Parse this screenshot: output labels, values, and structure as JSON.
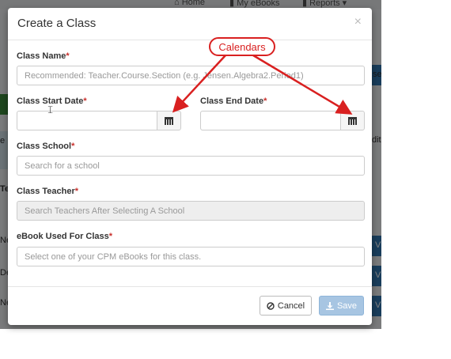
{
  "background": {
    "nav": {
      "home": "⌂ Home",
      "ebooks": "▮ My eBooks",
      "reports": "▮ Reports ▾"
    },
    "side_fragments": [
      "se",
      "dit",
      "Te",
      "Ne",
      "De",
      "Ne",
      "e",
      "V",
      "V",
      "V"
    ]
  },
  "modal": {
    "title": "Create a Class",
    "close": "×",
    "class_name": {
      "label": "Class Name",
      "required": "*",
      "placeholder": "Recommended: Teacher.Course.Section (e.g. Jensen.Algebra2.Period1)"
    },
    "start_date": {
      "label": "Class Start Date",
      "required": "*",
      "value": ""
    },
    "end_date": {
      "label": "Class End Date",
      "required": "*",
      "value": ""
    },
    "school": {
      "label": "Class School",
      "required": "*",
      "placeholder": "Search for a school"
    },
    "teacher": {
      "label": "Class Teacher",
      "required": "*",
      "placeholder": "Search Teachers After Selecting A School"
    },
    "ebook": {
      "label": "eBook Used For Class",
      "required": "*",
      "placeholder": "Select one of your CPM eBooks for this class."
    },
    "cancel_label": "Cancel",
    "save_label": "Save"
  },
  "annotation": {
    "text": "Calendars",
    "color": "#d92020"
  },
  "colors": {
    "required": "#c9302c",
    "save_button": "#a7c5e2",
    "accent_blue": "#337ab7"
  }
}
